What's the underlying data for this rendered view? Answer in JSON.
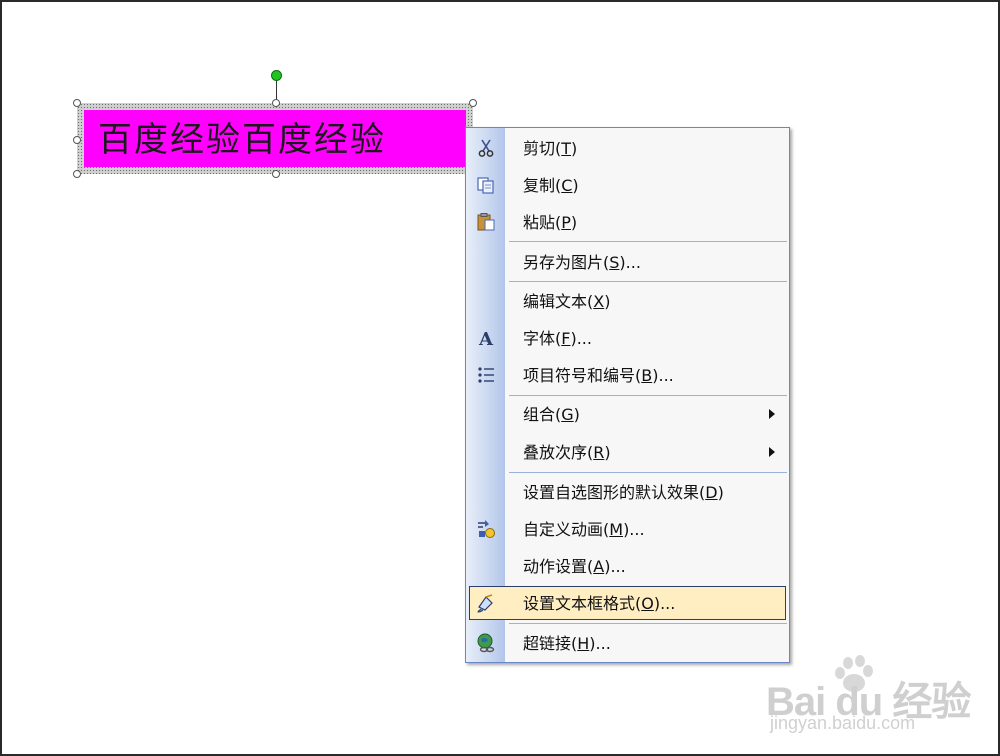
{
  "textbox": {
    "text": "百度经验百度经验",
    "fill_color": "#ff00ff"
  },
  "context_menu": {
    "items": [
      {
        "label": "剪切(",
        "key": "T",
        "suffix": ")",
        "icon": "scissors-icon",
        "name": "cut"
      },
      {
        "label": "复制(",
        "key": "C",
        "suffix": ")",
        "icon": "copy-icon",
        "name": "copy"
      },
      {
        "label": "粘贴(",
        "key": "P",
        "suffix": ")",
        "icon": "paste-icon",
        "name": "paste"
      },
      {
        "label": "另存为图片(",
        "key": "S",
        "suffix": ")...",
        "icon": "",
        "name": "save-as-picture"
      },
      {
        "label": "编辑文本(",
        "key": "X",
        "suffix": ")",
        "icon": "",
        "name": "edit-text"
      },
      {
        "label": "字体(",
        "key": "F",
        "suffix": ")...",
        "icon": "font-icon",
        "name": "font"
      },
      {
        "label": "项目符号和编号(",
        "key": "B",
        "suffix": ")...",
        "icon": "bullets-icon",
        "name": "bullets-numbering"
      },
      {
        "label": "组合(",
        "key": "G",
        "suffix": ")",
        "icon": "",
        "name": "group",
        "submenu": true
      },
      {
        "label": "叠放次序(",
        "key": "R",
        "suffix": ")",
        "icon": "",
        "name": "order",
        "submenu": true
      },
      {
        "label": "设置自选图形的默认效果(",
        "key": "D",
        "suffix": ")",
        "icon": "",
        "name": "set-autoshape-defaults"
      },
      {
        "label": "自定义动画(",
        "key": "M",
        "suffix": ")...",
        "icon": "custom-animation-icon",
        "name": "custom-animation"
      },
      {
        "label": "动作设置(",
        "key": "A",
        "suffix": ")...",
        "icon": "",
        "name": "action-settings"
      },
      {
        "label": "设置文本框格式(",
        "key": "O",
        "suffix": ")...",
        "icon": "format-textbox-icon",
        "name": "format-textbox",
        "highlighted": true
      },
      {
        "label": "超链接(",
        "key": "H",
        "suffix": ")...",
        "icon": "hyperlink-icon",
        "name": "hyperlink"
      }
    ]
  },
  "watermark": {
    "brand": "Bai du 经验",
    "url": "jingyan.baidu.com"
  }
}
